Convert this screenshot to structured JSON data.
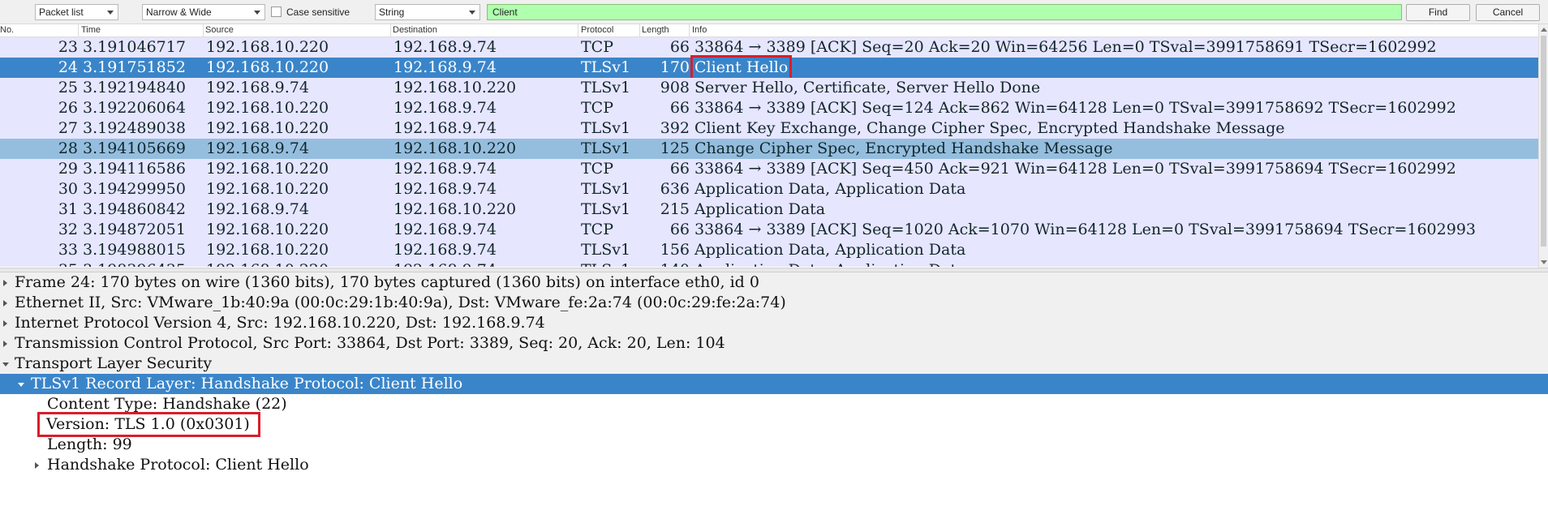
{
  "toolbar": {
    "search_in": "Packet list",
    "charset": "Narrow & Wide",
    "case_sensitive_label": "Case sensitive",
    "search_type": "String",
    "search_value": "Client",
    "find_label": "Find",
    "cancel_label": "Cancel"
  },
  "columns": [
    "No.",
    "Time",
    "Source",
    "Destination",
    "Protocol",
    "Length",
    "Info"
  ],
  "packets": [
    {
      "no": "23",
      "time": "3.191046717",
      "src": "192.168.10.220",
      "dst": "192.168.9.74",
      "proto": "TCP",
      "len": "66",
      "info": "33864 → 3389 [ACK] Seq=20 Ack=20 Win=64256 Len=0 TSval=3991758691 TSecr=1602992"
    },
    {
      "no": "24",
      "time": "3.191751852",
      "src": "192.168.10.220",
      "dst": "192.168.9.74",
      "proto": "TLSv1",
      "len": "170",
      "info": "Client Hello"
    },
    {
      "no": "25",
      "time": "3.192194840",
      "src": "192.168.9.74",
      "dst": "192.168.10.220",
      "proto": "TLSv1",
      "len": "908",
      "info": "Server Hello, Certificate, Server Hello Done"
    },
    {
      "no": "26",
      "time": "3.192206064",
      "src": "192.168.10.220",
      "dst": "192.168.9.74",
      "proto": "TCP",
      "len": "66",
      "info": "33864 → 3389 [ACK] Seq=124 Ack=862 Win=64128 Len=0 TSval=3991758692 TSecr=1602992"
    },
    {
      "no": "27",
      "time": "3.192489038",
      "src": "192.168.10.220",
      "dst": "192.168.9.74",
      "proto": "TLSv1",
      "len": "392",
      "info": "Client Key Exchange, Change Cipher Spec, Encrypted Handshake Message"
    },
    {
      "no": "28",
      "time": "3.194105669",
      "src": "192.168.9.74",
      "dst": "192.168.10.220",
      "proto": "TLSv1",
      "len": "125",
      "info": "Change Cipher Spec, Encrypted Handshake Message"
    },
    {
      "no": "29",
      "time": "3.194116586",
      "src": "192.168.10.220",
      "dst": "192.168.9.74",
      "proto": "TCP",
      "len": "66",
      "info": "33864 → 3389 [ACK] Seq=450 Ack=921 Win=64128 Len=0 TSval=3991758694 TSecr=1602992"
    },
    {
      "no": "30",
      "time": "3.194299950",
      "src": "192.168.10.220",
      "dst": "192.168.9.74",
      "proto": "TLSv1",
      "len": "636",
      "info": "Application Data, Application Data"
    },
    {
      "no": "31",
      "time": "3.194860842",
      "src": "192.168.9.74",
      "dst": "192.168.10.220",
      "proto": "TLSv1",
      "len": "215",
      "info": "Application Data"
    },
    {
      "no": "32",
      "time": "3.194872051",
      "src": "192.168.10.220",
      "dst": "192.168.9.74",
      "proto": "TCP",
      "len": "66",
      "info": "33864 → 3389 [ACK] Seq=1020 Ack=1070 Win=64128 Len=0 TSval=3991758694 TSecr=1602993"
    },
    {
      "no": "33",
      "time": "3.194988015",
      "src": "192.168.10.220",
      "dst": "192.168.9.74",
      "proto": "TLSv1",
      "len": "156",
      "info": "Application Data, Application Data"
    },
    {
      "no": "35",
      "time": "3.198396435",
      "src": "192.168.10.220",
      "dst": "192.168.9.74",
      "proto": "TLSv1",
      "len": "140",
      "info": "Application Data, Application Data"
    }
  ],
  "details": {
    "frame": "Frame 24: 170 bytes on wire (1360 bits), 170 bytes captured (1360 bits) on interface eth0, id 0",
    "ethernet": "Ethernet II, Src: VMware_1b:40:9a (00:0c:29:1b:40:9a), Dst: VMware_fe:2a:74 (00:0c:29:fe:2a:74)",
    "ip": "Internet Protocol Version 4, Src: 192.168.10.220, Dst: 192.168.9.74",
    "tcp": "Transmission Control Protocol, Src Port: 33864, Dst Port: 3389, Seq: 20, Ack: 20, Len: 104",
    "tls": "Transport Layer Security",
    "record_layer": "TLSv1 Record Layer: Handshake Protocol: Client Hello",
    "content_type": "Content Type: Handshake (22)",
    "version": "Version: TLS 1.0 (0x0301)",
    "length": "Length: 99",
    "handshake": "Handshake Protocol: Client Hello"
  },
  "colors": {
    "row_bg": "#e7e6ff",
    "selected_bg": "#3a85c9",
    "alt_selected_bg": "#95bede",
    "search_bg": "#afffaf",
    "annotation": "#d81e2b"
  }
}
